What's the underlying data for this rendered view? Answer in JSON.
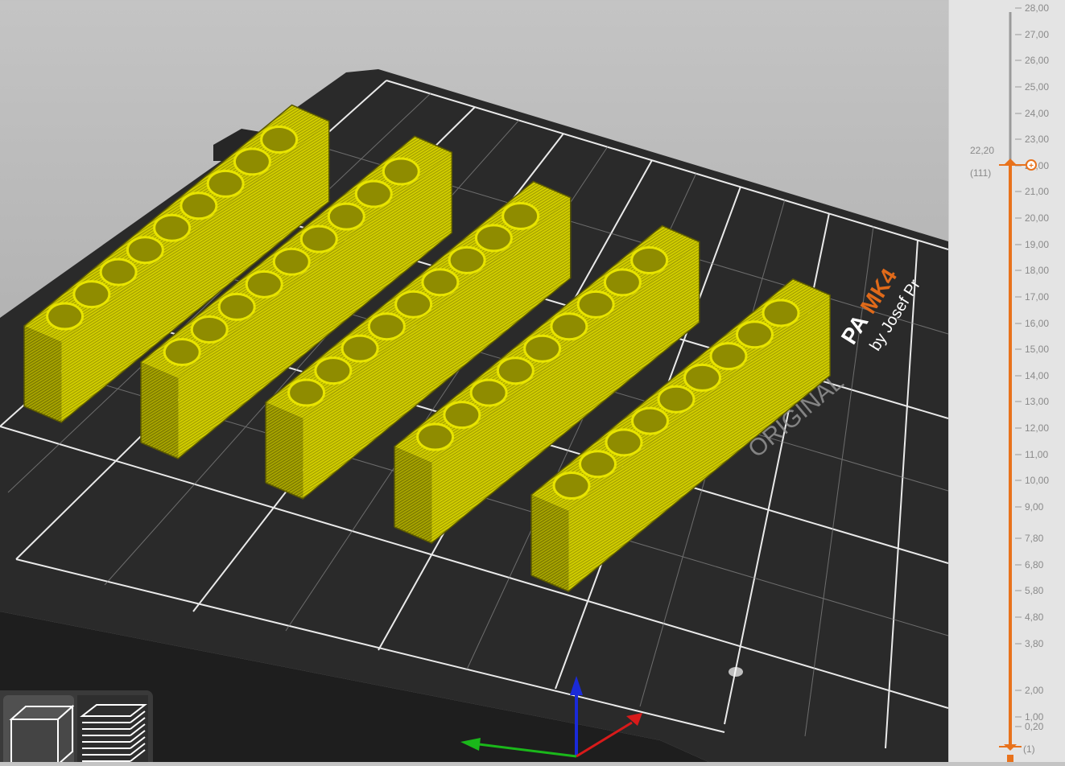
{
  "bed": {
    "brand_text": "PA",
    "model_text": "MK4",
    "sub_text": "by Josef Pr",
    "plate_text": "ORIGINAL",
    "model_color": "#e06a1a",
    "print_color": "#d4d000"
  },
  "layer_slider": {
    "top_label": "28,00",
    "current_height": "22,20",
    "current_layer": "(111)",
    "bottom_layer": "(1)",
    "accent_color": "#e8721c",
    "ticks": [
      "28,00",
      "27,00",
      "26,00",
      "25,00",
      "24,00",
      "23,00",
      "22,00",
      "21,00",
      "20,00",
      "19,00",
      "18,00",
      "17,00",
      "16,00",
      "15,00",
      "14,00",
      "13,00",
      "12,00",
      "11,00",
      "10,00",
      "9,00",
      "7,80",
      "6,80",
      "5,80",
      "4,80",
      "3,80",
      "2,00",
      "1,00",
      "0,20"
    ]
  },
  "view_toolbar": {
    "buttons": [
      {
        "name": "3d-view-button",
        "icon": "cube-icon"
      },
      {
        "name": "preview-button",
        "icon": "layers-icon"
      }
    ]
  }
}
